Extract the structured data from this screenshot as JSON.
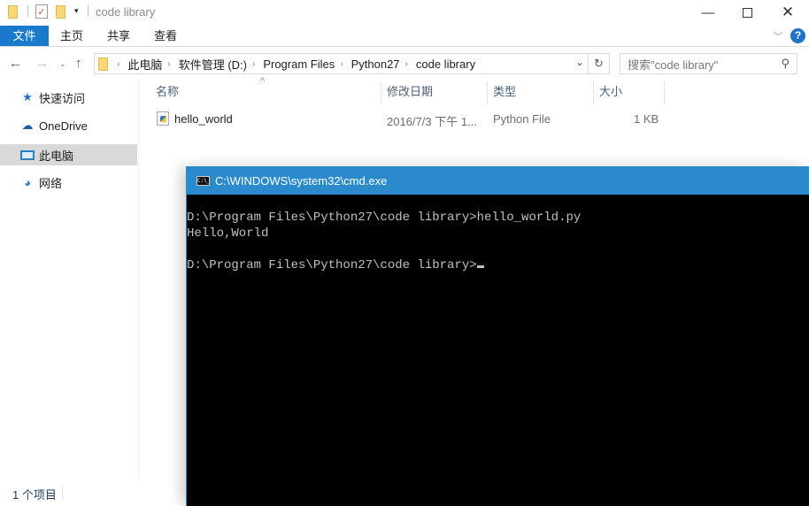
{
  "window": {
    "title": "code library",
    "minimize_icon": "minimize-icon",
    "maximize_icon": "maximize-icon",
    "close_icon": "close-icon"
  },
  "ribbon": {
    "tabs": [
      {
        "label": "文件",
        "active": true
      },
      {
        "label": "主页"
      },
      {
        "label": "共享"
      },
      {
        "label": "查看"
      }
    ],
    "accent": "#1979ca"
  },
  "address": {
    "crumbs": [
      "此电脑",
      "软件管理 (D:)",
      "Program Files",
      "Python27",
      "code library"
    ],
    "search_placeholder": "搜索\"code library\""
  },
  "sidebar": {
    "items": [
      {
        "label": "快速访问",
        "icon": "star-icon"
      },
      {
        "label": "OneDrive",
        "icon": "onedrive-icon"
      },
      {
        "label": "此电脑",
        "icon": "computer-icon",
        "selected": true
      },
      {
        "label": "网络",
        "icon": "network-icon"
      }
    ]
  },
  "files": {
    "columns": [
      "名称",
      "修改日期",
      "类型",
      "大小"
    ],
    "rows": [
      {
        "name": "hello_world",
        "modified": "2016/7/3 下午 1...",
        "type": "Python File",
        "size": "1 KB"
      }
    ]
  },
  "status": {
    "item_count": "1 个项目"
  },
  "cmd": {
    "title": "C:\\WINDOWS\\system32\\cmd.exe",
    "title_color": "#2b8acb",
    "lines": [
      "D:\\Program Files\\Python27\\code library>hello_world.py",
      "Hello,World",
      "",
      "D:\\Program Files\\Python27\\code library>"
    ]
  }
}
